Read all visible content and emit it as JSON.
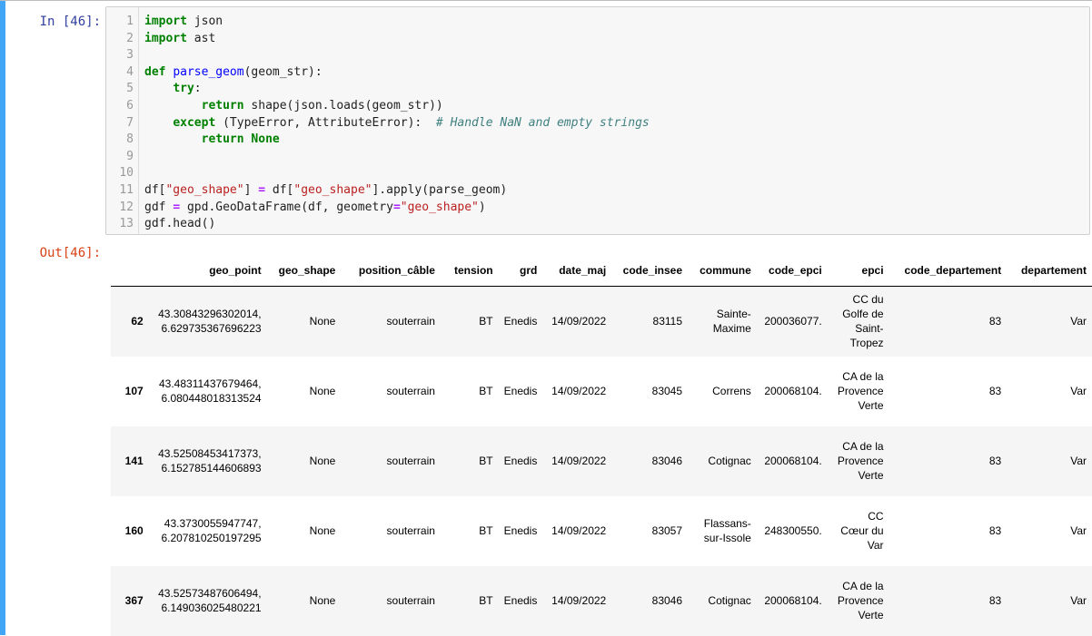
{
  "notebook": {
    "input_prompt": "In [46]:",
    "output_prompt": "Out[46]:",
    "line_numbers": [
      "1",
      "2",
      "3",
      "4",
      "5",
      "6",
      "7",
      "8",
      "9",
      "10",
      "11",
      "12",
      "13"
    ],
    "code_lines": [
      [
        {
          "t": "kw",
          "v": "import"
        },
        {
          "t": "",
          "v": " json"
        }
      ],
      [
        {
          "t": "kw",
          "v": "import"
        },
        {
          "t": "",
          "v": " ast"
        }
      ],
      [],
      [
        {
          "t": "kw",
          "v": "def"
        },
        {
          "t": "",
          "v": " "
        },
        {
          "t": "fn",
          "v": "parse_geom"
        },
        {
          "t": "",
          "v": "(geom_str):"
        }
      ],
      [
        {
          "t": "",
          "v": "    "
        },
        {
          "t": "kw",
          "v": "try"
        },
        {
          "t": "",
          "v": ":"
        }
      ],
      [
        {
          "t": "",
          "v": "        "
        },
        {
          "t": "kw",
          "v": "return"
        },
        {
          "t": "",
          "v": " shape(json.loads(geom_str))"
        }
      ],
      [
        {
          "t": "",
          "v": "    "
        },
        {
          "t": "kw",
          "v": "except"
        },
        {
          "t": "",
          "v": " (TypeError, AttributeError):  "
        },
        {
          "t": "cm",
          "v": "# Handle NaN and empty strings"
        }
      ],
      [
        {
          "t": "",
          "v": "        "
        },
        {
          "t": "kw",
          "v": "return"
        },
        {
          "t": "",
          "v": " "
        },
        {
          "t": "kw",
          "v": "None"
        }
      ],
      [],
      [],
      [
        {
          "t": "",
          "v": "df["
        },
        {
          "t": "st",
          "v": "\"geo_shape\""
        },
        {
          "t": "",
          "v": "] "
        },
        {
          "t": "op",
          "v": "="
        },
        {
          "t": "",
          "v": " df["
        },
        {
          "t": "st",
          "v": "\"geo_shape\""
        },
        {
          "t": "",
          "v": "].apply(parse_geom)"
        }
      ],
      [
        {
          "t": "",
          "v": "gdf "
        },
        {
          "t": "op",
          "v": "="
        },
        {
          "t": "",
          "v": " gpd.GeoDataFrame(df, geometry"
        },
        {
          "t": "op",
          "v": "="
        },
        {
          "t": "st",
          "v": "\"geo_shape\""
        },
        {
          "t": "",
          "v": ")"
        }
      ],
      [
        {
          "t": "",
          "v": "gdf.head()"
        }
      ]
    ]
  },
  "table": {
    "columns": [
      "",
      "geo_point",
      "geo_shape",
      "position_câble",
      "tension",
      "grd",
      "date_maj",
      "code_insee",
      "commune",
      "code_epci",
      "epci",
      "code_departement",
      "departement"
    ],
    "rows": [
      {
        "index": "62",
        "geo_point": [
          "43.30843296302014,",
          "6.629735367696223"
        ],
        "geo_shape": "None",
        "position_cable": "souterrain",
        "tension": "BT",
        "grd": "Enedis",
        "date_maj": "14/09/2022",
        "code_insee": "83115",
        "commune": [
          "Sainte-",
          "Maxime"
        ],
        "code_epci": "200036077.",
        "epci": [
          "CC du",
          "Golfe de",
          "Saint-",
          "Tropez"
        ],
        "code_departement": "83",
        "departement": "Var"
      },
      {
        "index": "107",
        "geo_point": [
          "43.48311437679464,",
          "6.080448018313524"
        ],
        "geo_shape": "None",
        "position_cable": "souterrain",
        "tension": "BT",
        "grd": "Enedis",
        "date_maj": "14/09/2022",
        "code_insee": "83045",
        "commune": [
          "Correns"
        ],
        "code_epci": "200068104.",
        "epci": [
          "CA de la",
          "Provence",
          "Verte"
        ],
        "code_departement": "83",
        "departement": "Var"
      },
      {
        "index": "141",
        "geo_point": [
          "43.52508453417373,",
          "6.152785144606893"
        ],
        "geo_shape": "None",
        "position_cable": "souterrain",
        "tension": "BT",
        "grd": "Enedis",
        "date_maj": "14/09/2022",
        "code_insee": "83046",
        "commune": [
          "Cotignac"
        ],
        "code_epci": "200068104.",
        "epci": [
          "CA de la",
          "Provence",
          "Verte"
        ],
        "code_departement": "83",
        "departement": "Var"
      },
      {
        "index": "160",
        "geo_point": [
          "43.3730055947747,",
          "6.207810250197295"
        ],
        "geo_shape": "None",
        "position_cable": "souterrain",
        "tension": "BT",
        "grd": "Enedis",
        "date_maj": "14/09/2022",
        "code_insee": "83057",
        "commune": [
          "Flassans-",
          "sur-Issole"
        ],
        "code_epci": "248300550.",
        "epci": [
          "CC",
          "Cœur du",
          "Var"
        ],
        "code_departement": "83",
        "departement": "Var"
      },
      {
        "index": "367",
        "geo_point": [
          "43.52573487606494,",
          "6.149036025480221"
        ],
        "geo_shape": "None",
        "position_cable": "souterrain",
        "tension": "BT",
        "grd": "Enedis",
        "date_maj": "14/09/2022",
        "code_insee": "83046",
        "commune": [
          "Cotignac"
        ],
        "code_epci": "200068104.",
        "epci": [
          "CA de la",
          "Provence",
          "Verte"
        ],
        "code_departement": "83",
        "departement": "Var"
      }
    ]
  }
}
